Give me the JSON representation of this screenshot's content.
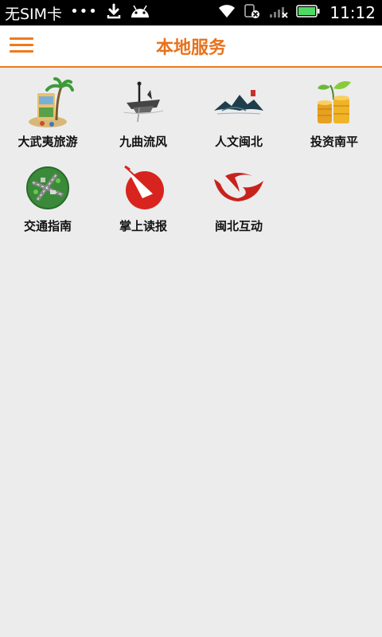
{
  "status_bar": {
    "carrier": "无SIM卡",
    "dots": "•••",
    "time": "11:12",
    "battery_color": "#4cd964"
  },
  "header": {
    "title": "本地服务",
    "accent_color": "#ee7a1e"
  },
  "services": [
    {
      "label": "大武夷旅游",
      "icon": "travel-icon"
    },
    {
      "label": "九曲流风",
      "icon": "boat-icon"
    },
    {
      "label": "人文闽北",
      "icon": "mountain-icon"
    },
    {
      "label": "投资南平",
      "icon": "coins-icon"
    },
    {
      "label": "交通指南",
      "icon": "globe-icon"
    },
    {
      "label": "掌上读报",
      "icon": "newspaper-icon"
    },
    {
      "label": "闽北互动",
      "icon": "interact-icon"
    }
  ]
}
